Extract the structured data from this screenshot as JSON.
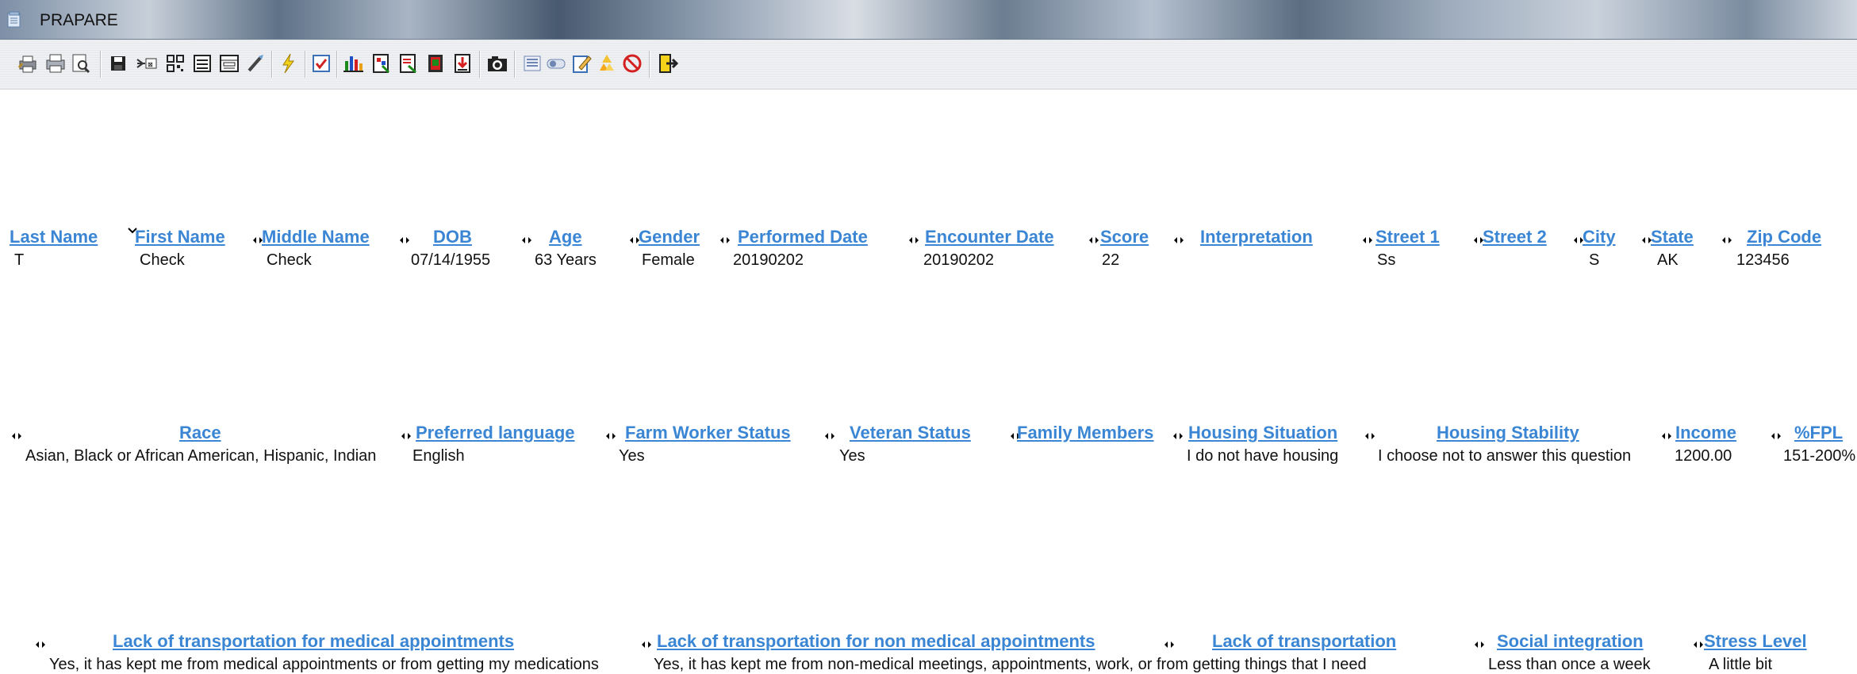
{
  "window": {
    "title": "PRAPARE"
  },
  "toolbar": {
    "icons": [
      "print-icon",
      "print-setup-icon",
      "print-preview-icon",
      "save-icon",
      "export-icon",
      "qr-code-icon",
      "form-view-icon",
      "field-layout-icon",
      "brush-icon",
      "lightning-icon",
      "checkbox-icon",
      "bar-chart-icon",
      "report-icon",
      "report-alt-icon",
      "book-icon",
      "import-icon",
      "camera-icon",
      "list-view-icon",
      "toggle-icon",
      "edit-note-icon",
      "recycle-icon",
      "cancel-icon",
      "exit-icon"
    ]
  },
  "row1": {
    "headers": [
      "Last Name",
      "First Name",
      "Middle Name",
      "DOB",
      "Age",
      "Gender",
      "Performed Date",
      "Encounter Date",
      "Score",
      "Interpretation",
      "Street 1",
      "Street 2",
      "City",
      "State",
      "Zip Code"
    ],
    "values": [
      "T",
      "Check",
      "Check",
      "07/14/1955",
      "63 Years",
      "Female",
      "20190202",
      "20190202",
      "22",
      "",
      "Ss",
      "",
      "S",
      "AK",
      "123456"
    ]
  },
  "row2": {
    "headers": [
      "Race",
      "Preferred language",
      "Farm Worker Status",
      "Veteran Status",
      "Family Members",
      "Housing Situation",
      "Housing Stability",
      "Income",
      "%FPL"
    ],
    "values": [
      "Asian, Black or African American, Hispanic, Indian",
      "English",
      "Yes",
      "Yes",
      "",
      "I do not have housing",
      "I choose not to answer this question",
      "1200.00",
      "151-200%"
    ]
  },
  "row3": {
    "headers": [
      "Lack of transportation for medical appointments",
      "Lack of transportation for non medical appointments",
      "Lack of transportation",
      "Social integration",
      "Stress Level"
    ],
    "values": [
      "Yes, it has kept me from medical appointments or from getting my medications",
      "Yes, it has kept me from non-medical meetings, appointments, work, or from getting things that I need",
      "",
      "Less than once a week",
      "A little bit"
    ]
  },
  "colors": {
    "header_link": "#3a86d4",
    "value_text": "#111111"
  }
}
